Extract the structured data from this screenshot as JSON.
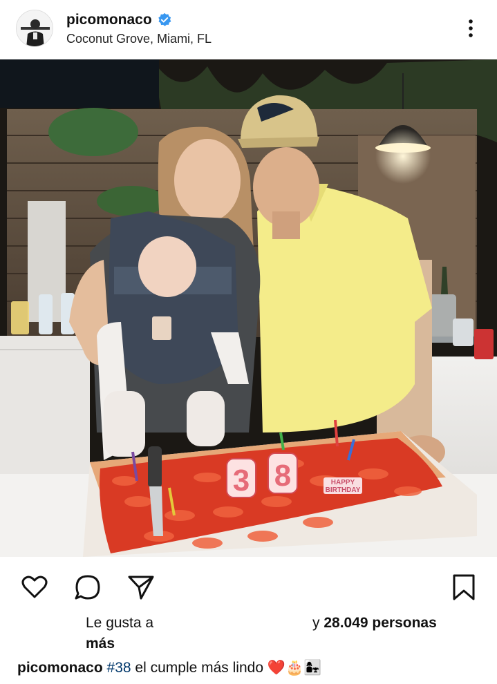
{
  "post": {
    "username": "picomonaco",
    "verified": true,
    "location": "Coconut Grove, Miami, FL"
  },
  "photo": {
    "cake_number": "38",
    "cake_text": "HAPPY BIRTHDAY"
  },
  "likes": {
    "prefix": "Le gusta a",
    "count_prefix": "y",
    "count": "28.049",
    "count_suffix": "personas",
    "more": "más"
  },
  "caption": {
    "username": "picomonaco",
    "hashtag": "#38",
    "text": "el cumple más lindo",
    "emoji": "❤️🎂👩‍👧"
  },
  "colors": {
    "verified": "#3897f0",
    "hashtag": "#00376b",
    "text": "#111111"
  },
  "icons": [
    "verified-badge-icon",
    "more-options-icon",
    "heart-icon",
    "comment-icon",
    "share-icon",
    "bookmark-icon"
  ]
}
